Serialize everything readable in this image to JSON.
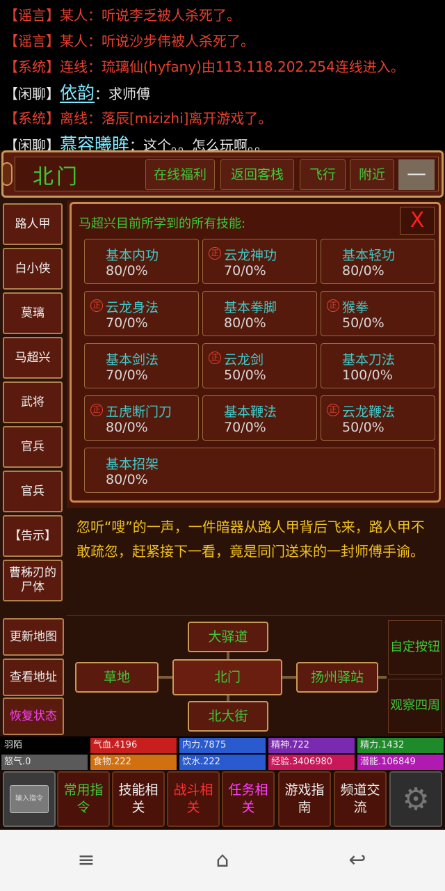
{
  "chat": [
    {
      "tag": "【谣言】",
      "tag_type": "rumor",
      "text": "某人：听说李乏被人杀死了。",
      "color": "red"
    },
    {
      "tag": "【谣言】",
      "tag_type": "rumor",
      "text": "某人：听说沙步伟被人杀死了。",
      "color": "red"
    },
    {
      "tag": "【系统】",
      "tag_type": "system",
      "text": "连线：琉璃仙(hyfany)由113.118.202.254连线进入。",
      "color": "red"
    },
    {
      "tag": "【闲聊】",
      "tag_type": "chat",
      "speaker": "依韵",
      "text": "：求师傅",
      "color": "white"
    },
    {
      "tag": "【系统】",
      "tag_type": "system",
      "text": "离线：落辰[mizizhi]离开游戏了。",
      "color": "red"
    },
    {
      "tag": "【闲聊】",
      "tag_type": "chat",
      "speaker": "慕容曦眸",
      "text": "：这个。。怎么玩啊。。",
      "color": "white"
    }
  ],
  "location": {
    "name": "北门",
    "buttons": [
      "在线福利",
      "返回客栈",
      "飞行",
      "附近"
    ],
    "minus": "—"
  },
  "npcs": [
    "路人甲",
    "白小侠",
    "莫璃",
    "马超兴",
    "武将",
    "官兵",
    "官兵",
    "【告示】",
    "曹秭刃的尸体"
  ],
  "skills_panel": {
    "title": "马超兴目前所学到的所有技能:",
    "close": "X",
    "seal_glyph": "正",
    "skills": [
      {
        "name": "基本内功",
        "progress": "80/0%",
        "special": false
      },
      {
        "name": "云龙神功",
        "progress": "70/0%",
        "special": true
      },
      {
        "name": "基本轻功",
        "progress": "80/0%",
        "special": false
      },
      {
        "name": "云龙身法",
        "progress": "70/0%",
        "special": true
      },
      {
        "name": "基本拳脚",
        "progress": "80/0%",
        "special": false
      },
      {
        "name": "猴拳",
        "progress": "50/0%",
        "special": true
      },
      {
        "name": "基本剑法",
        "progress": "70/0%",
        "special": false
      },
      {
        "name": "云龙剑",
        "progress": "50/0%",
        "special": true
      },
      {
        "name": "基本刀法",
        "progress": "100/0%",
        "special": false
      },
      {
        "name": "五虎断门刀",
        "progress": "80/0%",
        "special": true
      },
      {
        "name": "基本鞭法",
        "progress": "70/0%",
        "special": false
      },
      {
        "name": "云龙鞭法",
        "progress": "50/0%",
        "special": true
      },
      {
        "name": "基本招架",
        "progress": "80/0%",
        "special": false
      }
    ]
  },
  "message": "忽听“嗖”的一声，一件暗器从路人甲背后飞来，路人甲不敢疏忽，赶紧接下一看，竟是同门送来的一封师傅手谕。",
  "system_buttons": [
    "更新地图",
    "查看地址",
    "恢复状态"
  ],
  "map": {
    "north": "大驿道",
    "west": "草地",
    "center": "北门",
    "east": "扬州驿站",
    "south": "北大街",
    "custom": "自定按钮",
    "observe": "观察四周"
  },
  "stats": [
    {
      "label": "羽陌",
      "color": "#000000"
    },
    {
      "label": "气血.4196",
      "color": "#c81e1e"
    },
    {
      "label": "内力.7875",
      "color": "#2a5ad0"
    },
    {
      "label": "精神.722",
      "color": "#7a2ab0"
    },
    {
      "label": "精力.1432",
      "color": "#1e8a2a"
    },
    {
      "label": "怒气.0",
      "color": "#5a5a5a"
    },
    {
      "label": "食物.222",
      "color": "#d07010"
    },
    {
      "label": "饮水.222",
      "color": "#2a5ad0"
    },
    {
      "label": "经验.3406980",
      "color": "#c8185a"
    },
    {
      "label": "潜能.106849",
      "color": "#b01ab0"
    }
  ],
  "toolbar": {
    "input_label": "输入指令",
    "buttons": [
      {
        "label": "常用指令",
        "color": "#3ec83a"
      },
      {
        "label": "技能相关",
        "color": "#f0f0f0"
      },
      {
        "label": "战斗相关",
        "color": "#ff3030"
      },
      {
        "label": "任务相关",
        "color": "#ff40ff"
      },
      {
        "label": "游戏指南",
        "color": "#f0f0f0"
      },
      {
        "label": "频道交流",
        "color": "#f0f0f0"
      }
    ],
    "gear_glyph": "⚙"
  },
  "nav": {
    "menu": "≡",
    "home": "⌂",
    "back": "↩"
  }
}
